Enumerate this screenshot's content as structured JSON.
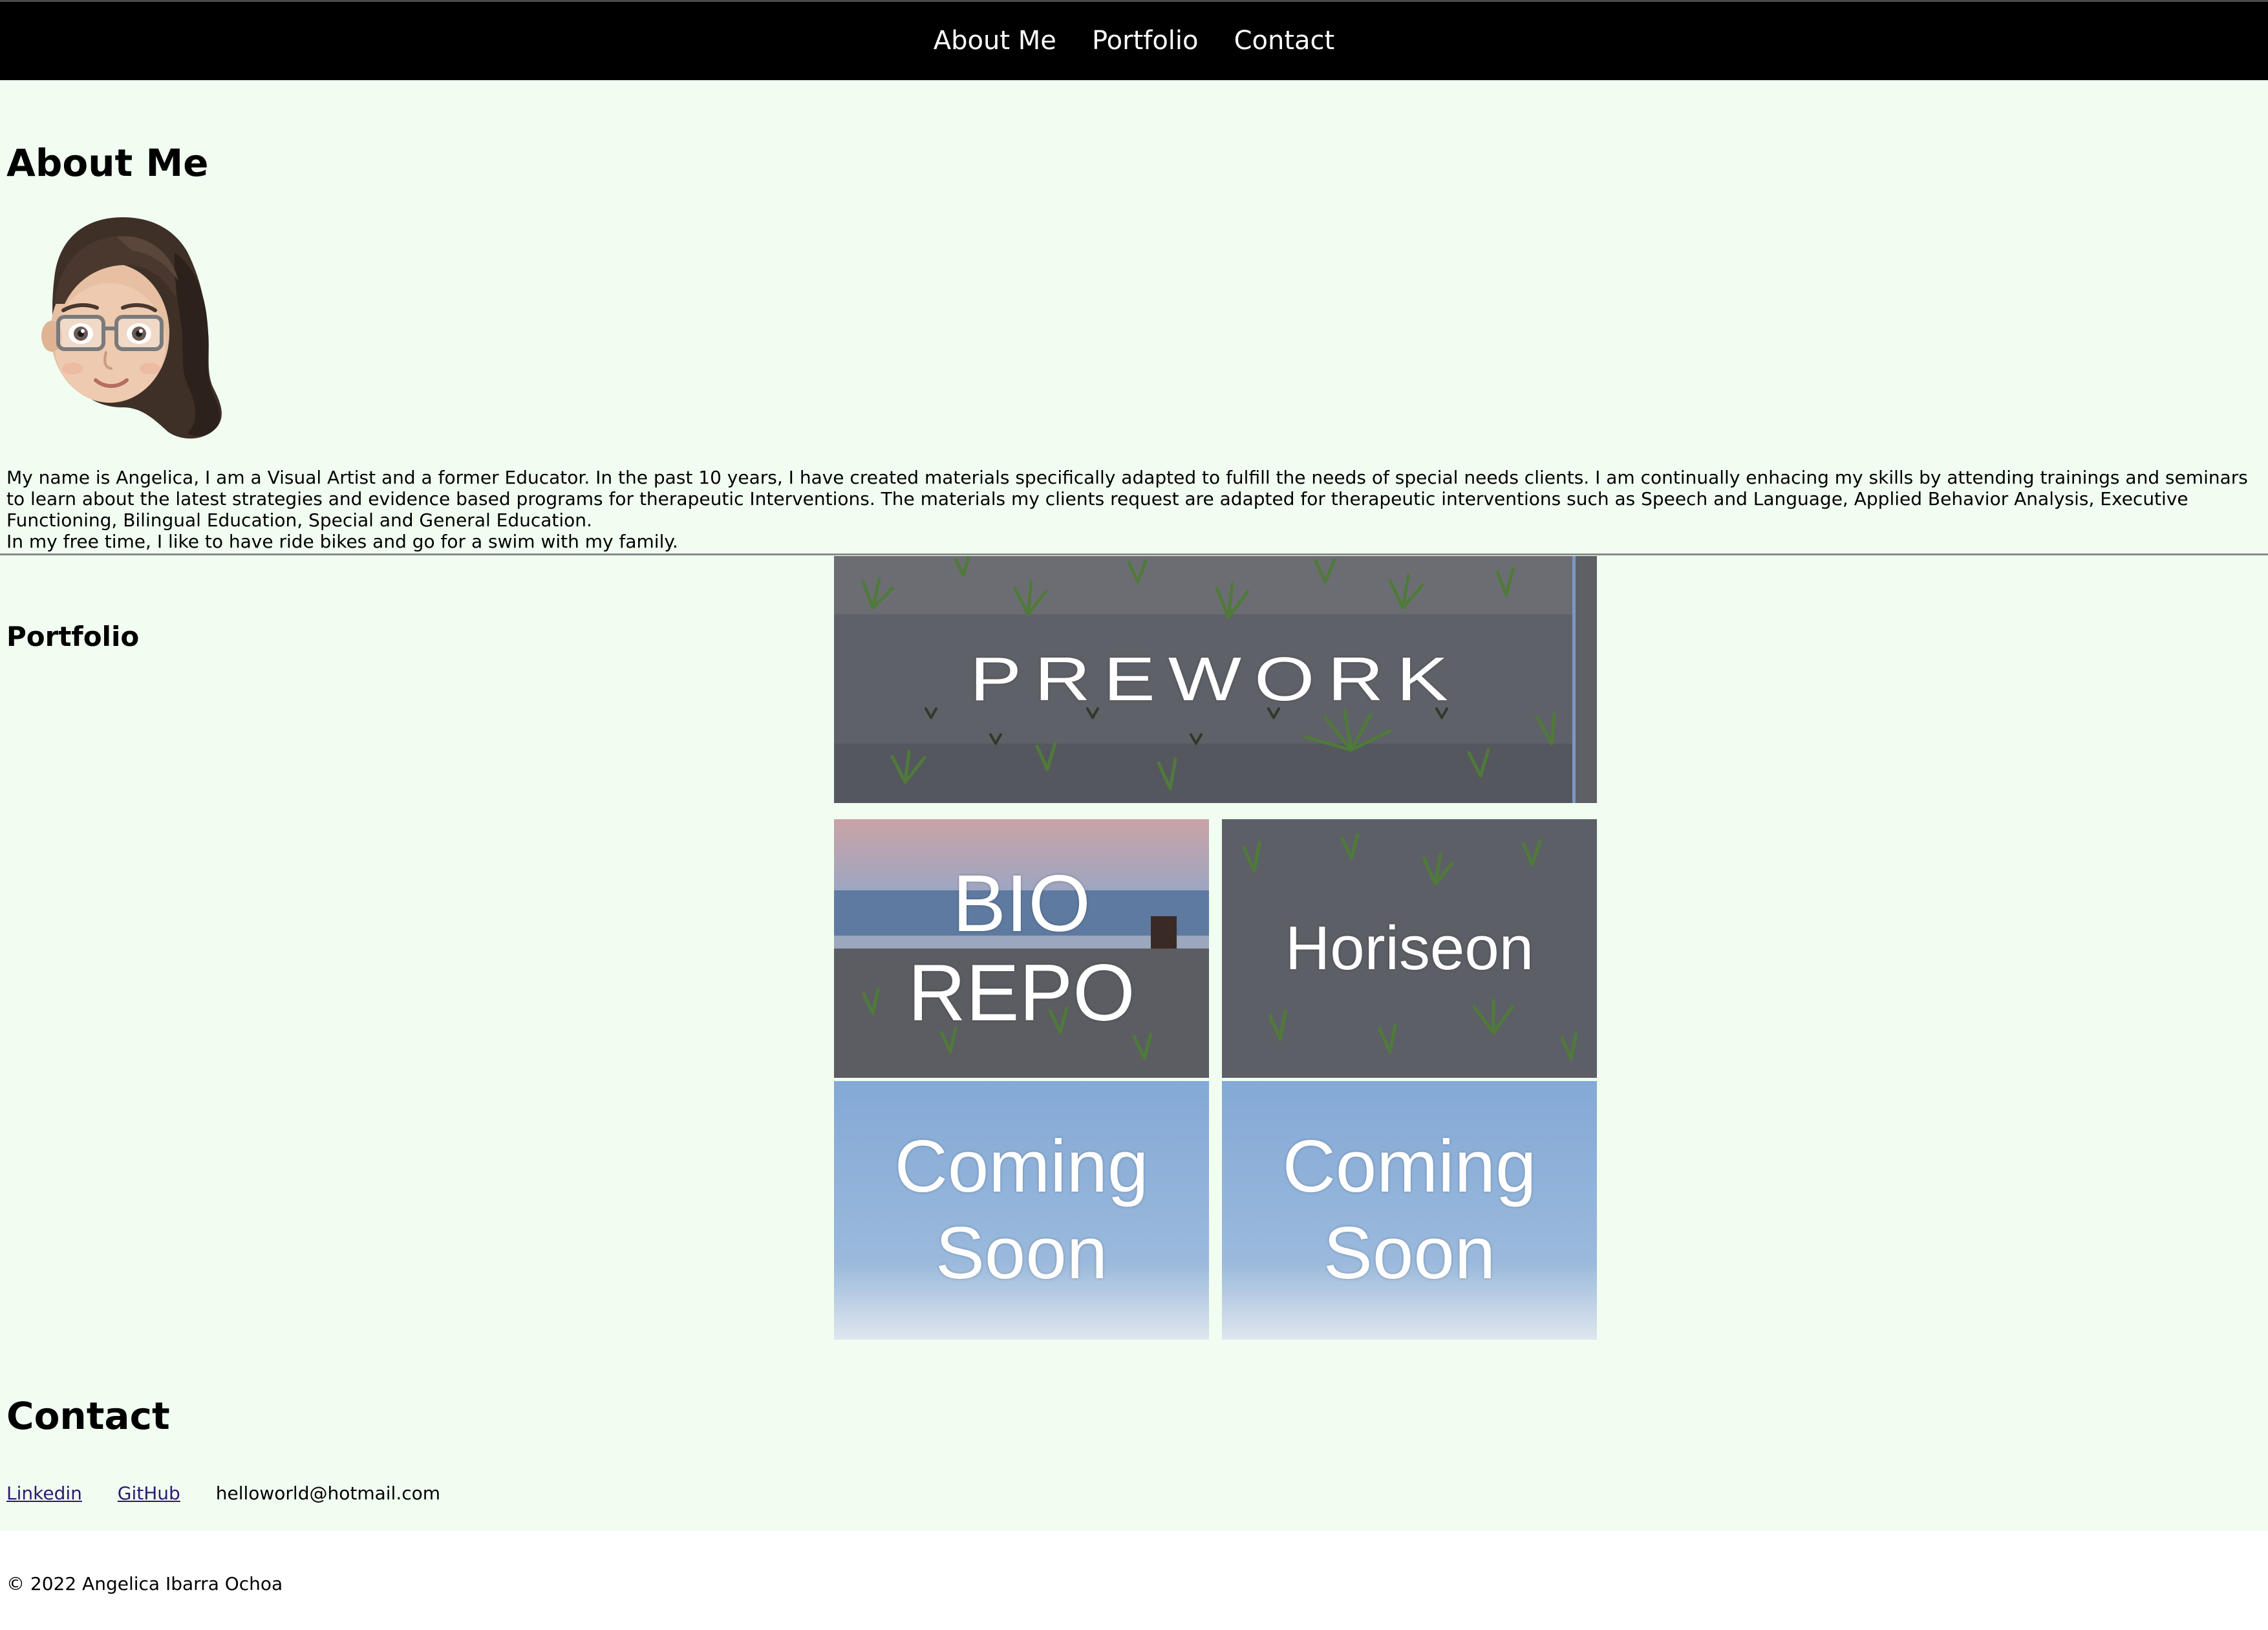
{
  "nav": {
    "items": [
      {
        "label": "About Me"
      },
      {
        "label": "Portfolio"
      },
      {
        "label": "Contact"
      }
    ]
  },
  "about": {
    "title": "About Me",
    "avatar_icon": "memoji-avatar-icon",
    "bio": "My name is Angelica, I am a Visual Artist and a former Educator. In the past 10 years, I have created materials specifically adapted to fulfill the needs of special needs clients. I am continually enhacing my skills by attending trainings and seminars to learn about the latest strategies and evidence based programs for therapeutic Interventions. The materials my clients request are adapted for therapeutic interventions such as Speech and Language, Applied Behavior Analysis, Executive Functioning, Bilingual Education, Special and General Education.",
    "free_time": "In my free time, I like to have ride bikes and go for a swim with my family."
  },
  "portfolio": {
    "title": "Portfolio",
    "projects": [
      {
        "line1": "PREWORK",
        "line2": ""
      },
      {
        "line1": "BIO",
        "line2": "REPO"
      },
      {
        "line1": "Horiseon",
        "line2": ""
      },
      {
        "line1": "Coming",
        "line2": "Soon"
      },
      {
        "line1": "Coming",
        "line2": "Soon"
      }
    ]
  },
  "contact": {
    "title": "Contact",
    "linkedin": "Linkedin",
    "github": "GitHub",
    "email": "helloworld@hotmail.com"
  },
  "footer": {
    "text": "© 2022 Angelica Ibarra Ochoa"
  },
  "colors": {
    "page_bg": "#f1fdf1",
    "nav_bg": "#000000",
    "link": "#2c1a73"
  }
}
